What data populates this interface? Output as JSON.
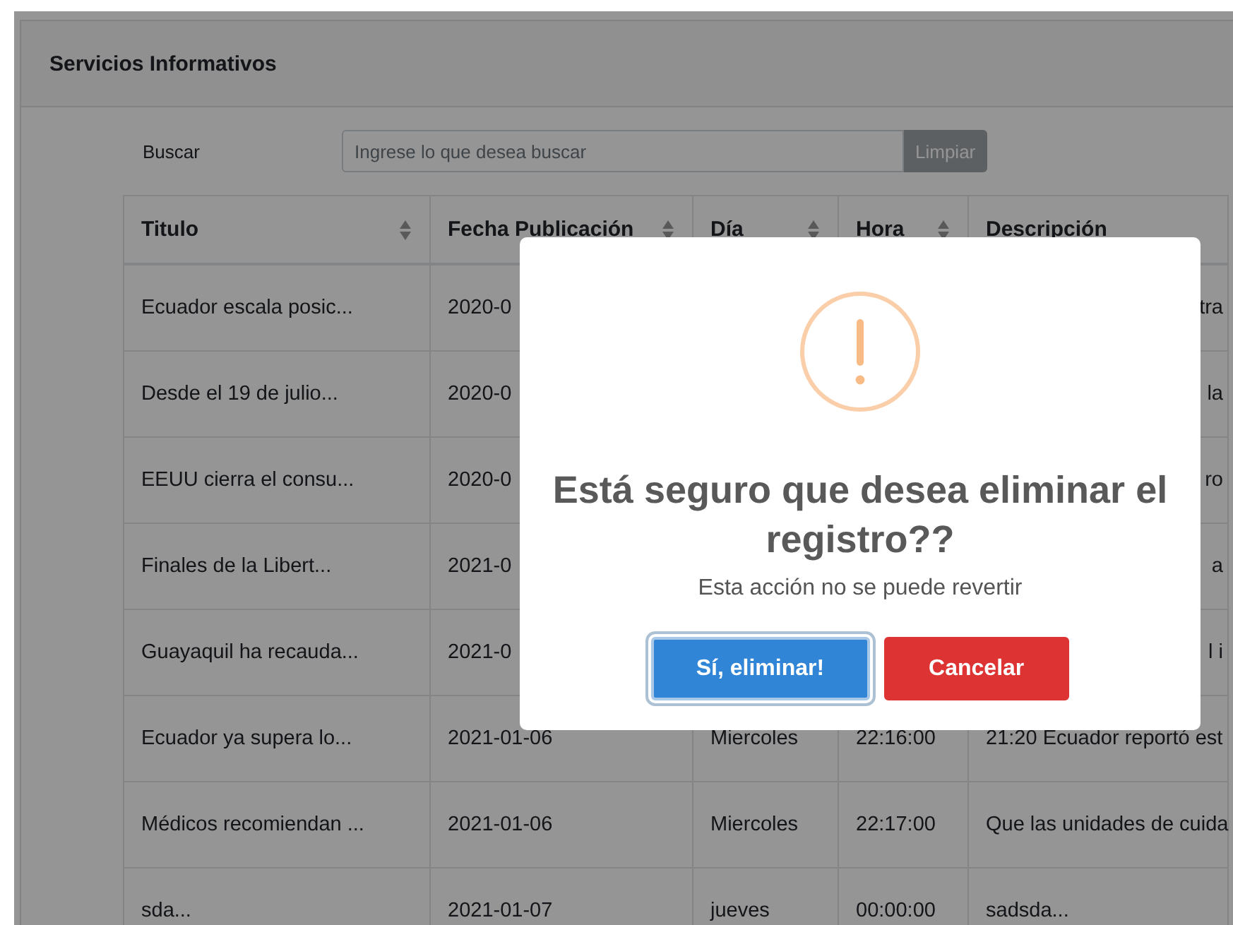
{
  "card": {
    "title": "Servicios Informativos"
  },
  "search": {
    "label": "Buscar",
    "placeholder": "Ingrese lo que desea buscar",
    "button": "Limpiar"
  },
  "table": {
    "columns": [
      {
        "label": "Titulo",
        "sortable": true
      },
      {
        "label": "Fecha Publicación",
        "sortable": true
      },
      {
        "label": "Día",
        "sortable": true
      },
      {
        "label": "Hora",
        "sortable": true
      },
      {
        "label": "Descripción",
        "sortable": false
      }
    ],
    "rows": [
      {
        "cells": [
          "Ecuador escala posic...",
          "2020-0",
          null,
          null,
          "tra"
        ]
      },
      {
        "cells": [
          "Desde el 19 de julio...",
          "2020-0",
          null,
          null,
          "la"
        ]
      },
      {
        "cells": [
          "EEUU cierra el consu...",
          "2020-0",
          null,
          null,
          "ro"
        ]
      },
      {
        "cells": [
          "Finales de la Libert...",
          "2021-0",
          null,
          null,
          "a"
        ]
      },
      {
        "cells": [
          "Guayaquil ha recauda...",
          "2021-0",
          null,
          null,
          "l i"
        ]
      },
      {
        "cells": [
          "Ecuador ya supera lo...",
          "2021-01-06",
          "Miercoles",
          "22:16:00",
          "21:20 Ecuador reportó est"
        ]
      },
      {
        "cells": [
          "Médicos recomiendan ...",
          "2021-01-06",
          "Miercoles",
          "22:17:00",
          "Que las unidades de cuida"
        ]
      },
      {
        "cells": [
          "sda...",
          "2021-01-07",
          "jueves",
          "00:00:00",
          "sadsda..."
        ]
      }
    ]
  },
  "dialog": {
    "title": "Está seguro que desea eliminar el registro??",
    "text": "Esta acción no se puede revertir",
    "buttons": [
      {
        "label": "Sí, eliminar!",
        "kind": "confirm",
        "focused": true
      },
      {
        "label": "Cancelar",
        "kind": "cancel",
        "focused": false
      }
    ]
  }
}
